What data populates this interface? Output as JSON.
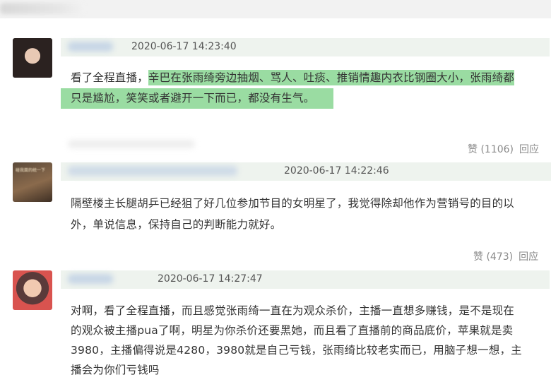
{
  "comments": [
    {
      "date": "2020-06-17 14:23:40",
      "text_lead": "看了全程直播，",
      "text_hl1": "辛巴在张雨绮旁边抽烟、骂人、吐痰、推销情趣内衣比钢圈大小，张雨绮都",
      "text_hl2": "只是尴尬，笑笑或者避开一下而已，都没有生气。",
      "like_label": "赞 (1106)",
      "reply_label": "回应"
    },
    {
      "date": "2020-06-17 14:22:46",
      "avatar_text": "碰我面的统一下",
      "text_line1": "隔壁楼主长腿胡乒已经狙了好几位参加节目的女明星了，我觉得除却他作为营销号的目的以",
      "text_line2": "外，单说信息，保持自己的判断能力就好。",
      "like_label": "赞 (473)",
      "reply_label": "回应"
    },
    {
      "date": "2020-06-17 14:27:47",
      "text_line1": "对啊，看了全程直播，而且感觉张雨绮一直在为观众杀价，主播一直想多赚钱，是不是现在",
      "text_line2": "的观众被主播pua了啊，明星为你杀价还要黑她，而且看了直播前的商品底价，苹果就是卖",
      "text_line3": "3980，主播偏得说是4280，3980就是自己亏钱，张雨绮比较老实而已，用脑子想一想，主",
      "text_line4": "播会为你们亏钱吗"
    }
  ]
}
